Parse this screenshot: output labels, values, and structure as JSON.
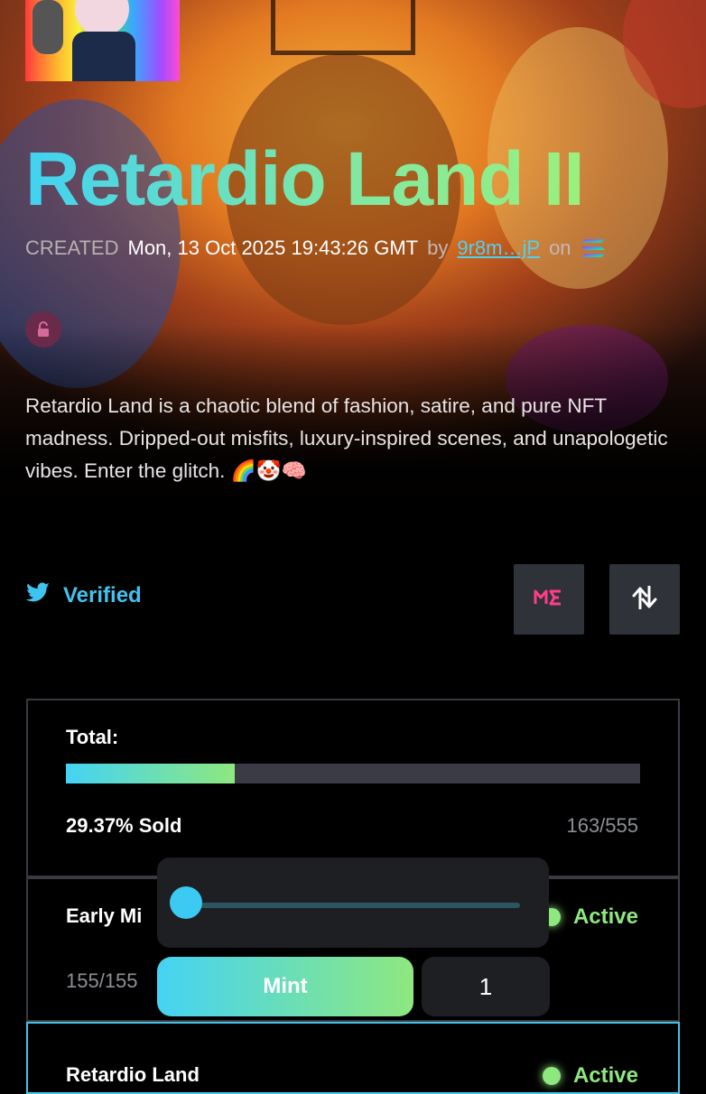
{
  "collection": {
    "title": "Retardio Land II",
    "created_label": "CREATED",
    "created_date": "Mon, 13 Oct 2025 19:43:26 GMT",
    "by_label": "by",
    "creator_address": "9r8m…jP",
    "on_label": "on",
    "chain_icon": "solana-icon",
    "lock_icon": "unlock-icon",
    "description": "Retardio Land is a chaotic blend of fashion, satire, and pure NFT madness. Dripped-out misfits, luxury-inspired scenes, and unapologetic vibes. Enter the glitch. 🌈🤡🧠"
  },
  "social": {
    "twitter_icon": "twitter-icon",
    "verified_label": "Verified",
    "magic_eden_icon": "magic-eden-icon",
    "tensor_icon": "tensor-icon"
  },
  "total": {
    "label": "Total:",
    "progress_fraction": 0.2937,
    "sold_text": "29.37% Sold",
    "count": "163/555"
  },
  "phases": [
    {
      "name": "Early Mi",
      "count": "155/155",
      "status": "Active"
    },
    {
      "name": "Retardio Land",
      "status": "Active"
    }
  ],
  "mint_panel": {
    "slider_fraction": 0,
    "mint_label": "Mint",
    "quantity": "1"
  },
  "colors": {
    "accent_cyan": "#45d3f4",
    "accent_green": "#8ee87f",
    "card_border": "#3a3a42",
    "panel_bg": "#1e1f23"
  }
}
